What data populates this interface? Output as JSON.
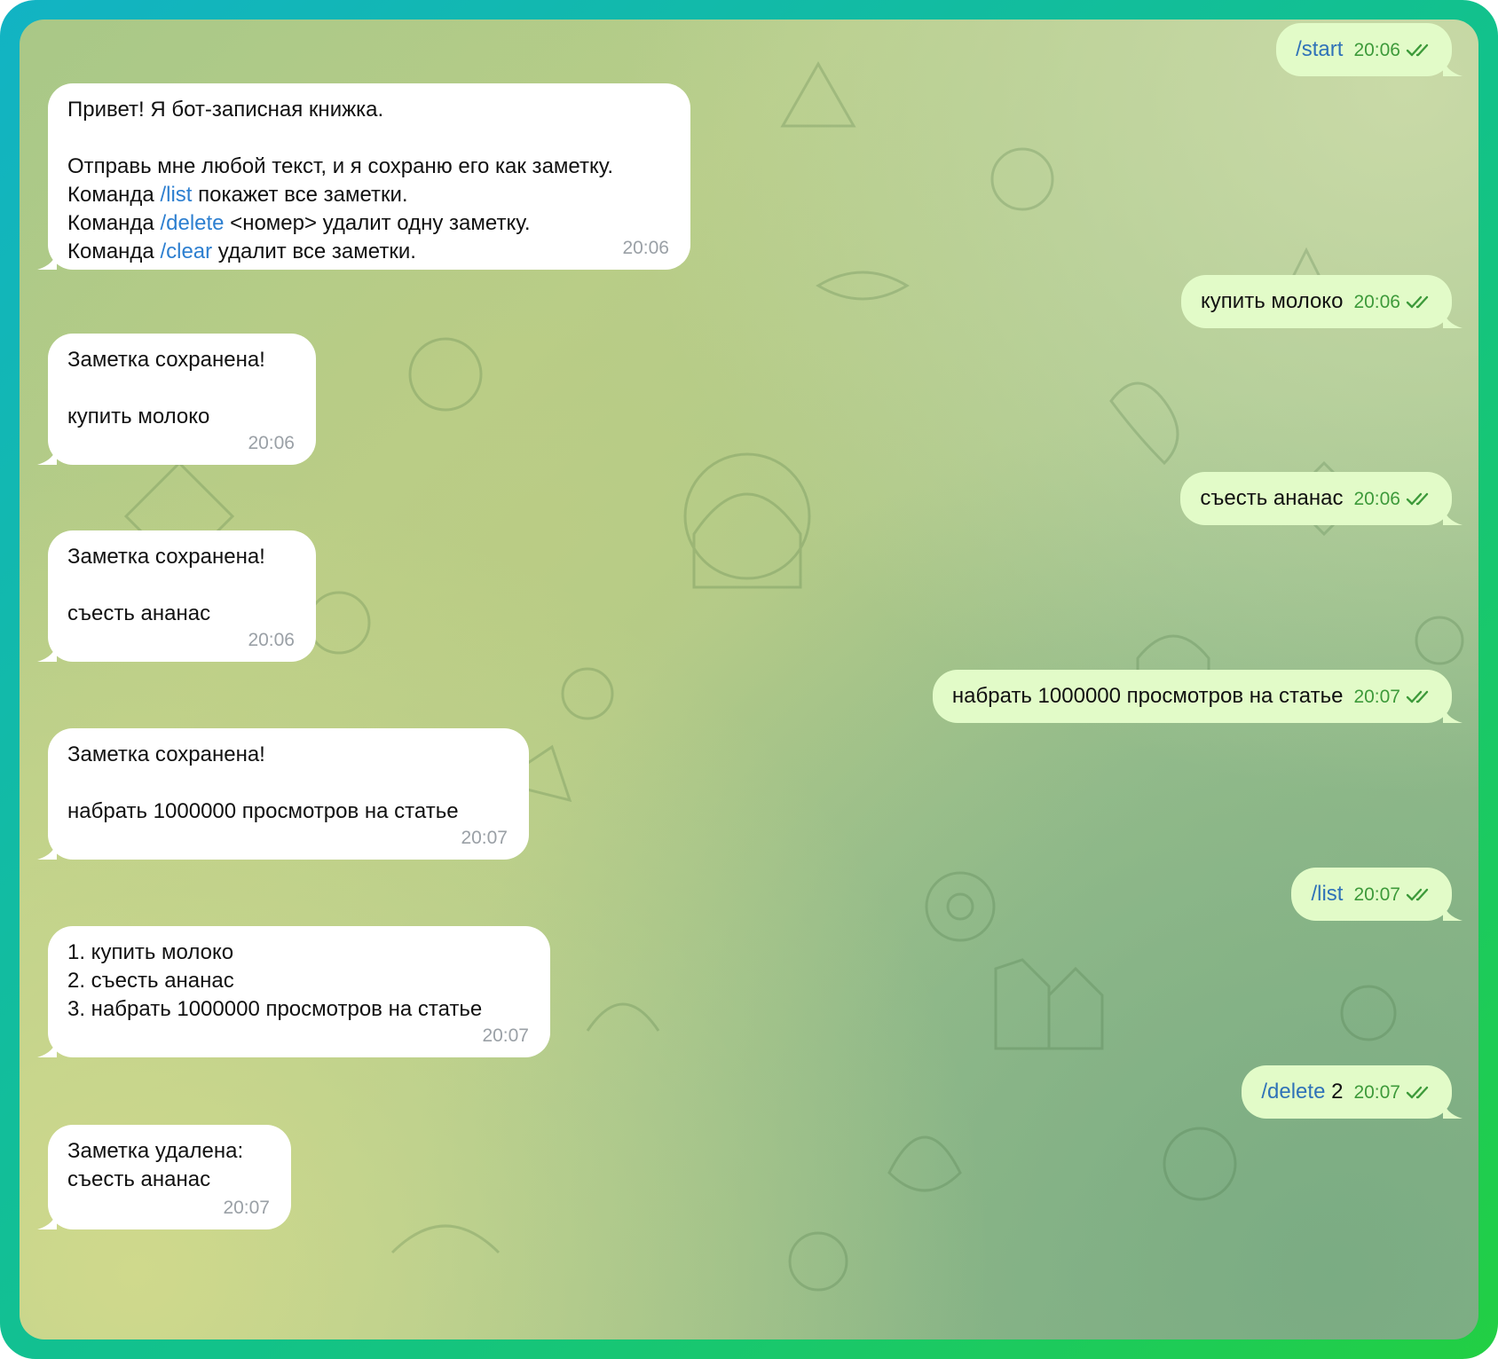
{
  "incoming": [
    {
      "lines": [
        [
          {
            "t": "Привет! Я бот-записная книжка."
          }
        ],
        [],
        [
          {
            "t": "Отправь мне любой текст, и я сохраню его как заметку."
          }
        ],
        [
          {
            "t": "Команда "
          },
          {
            "t": "/list",
            "cmd": true
          },
          {
            "t": " покажет все заметки."
          }
        ],
        [
          {
            "t": "Команда "
          },
          {
            "t": "/delete",
            "cmd": true
          },
          {
            "t": " <номер> удалит одну заметку."
          }
        ],
        [
          {
            "t": "Команда "
          },
          {
            "t": "/clear",
            "cmd": true
          },
          {
            "t": " удалит все заметки."
          }
        ]
      ],
      "time": "20:06"
    },
    {
      "lines": [
        [
          {
            "t": "Заметка сохранена!"
          }
        ],
        [],
        [
          {
            "t": "купить молоко"
          }
        ]
      ],
      "time": "20:06"
    },
    {
      "lines": [
        [
          {
            "t": "Заметка сохранена!"
          }
        ],
        [],
        [
          {
            "t": "съесть ананас"
          }
        ]
      ],
      "time": "20:06"
    },
    {
      "lines": [
        [
          {
            "t": "Заметка сохранена!"
          }
        ],
        [],
        [
          {
            "t": "набрать 1000000 просмотров на статье"
          }
        ]
      ],
      "time": "20:07"
    },
    {
      "lines": [
        [
          {
            "t": "1. купить молоко"
          }
        ],
        [
          {
            "t": "2. съесть ананас"
          }
        ],
        [
          {
            "t": "3. набрать 1000000 просмотров на статье"
          }
        ]
      ],
      "time": "20:07"
    },
    {
      "lines": [
        [
          {
            "t": "Заметка удалена:"
          }
        ],
        [
          {
            "t": "съесть ананас"
          }
        ]
      ],
      "time": "20:07"
    }
  ],
  "outgoing": [
    {
      "parts": [
        {
          "t": "/start",
          "cmd": true
        }
      ],
      "time": "20:06",
      "status": "read"
    },
    {
      "parts": [
        {
          "t": "купить молоко"
        }
      ],
      "time": "20:06",
      "status": "read"
    },
    {
      "parts": [
        {
          "t": "съесть ананас"
        }
      ],
      "time": "20:06",
      "status": "read"
    },
    {
      "parts": [
        {
          "t": "набрать 1000000 просмотров на статье"
        }
      ],
      "time": "20:07",
      "status": "read"
    },
    {
      "parts": [
        {
          "t": "/list",
          "cmd": true
        }
      ],
      "time": "20:07",
      "status": "read"
    },
    {
      "parts": [
        {
          "t": "/delete",
          "cmd": true
        },
        {
          "t": " 2"
        }
      ],
      "time": "20:07",
      "status": "read"
    }
  ],
  "colors": {
    "incoming_bubble": "#ffffff",
    "outgoing_bubble": "#e2fbc8",
    "command_link": "#2d7fd0",
    "outgoing_time": "#3d9a3a",
    "incoming_time": "#9aa0a6",
    "frame_gradient_start": "#12b3c4",
    "frame_gradient_end": "#22cf43"
  },
  "icons": {
    "read_status": "double-check-icon",
    "background": "doodle-pattern"
  }
}
